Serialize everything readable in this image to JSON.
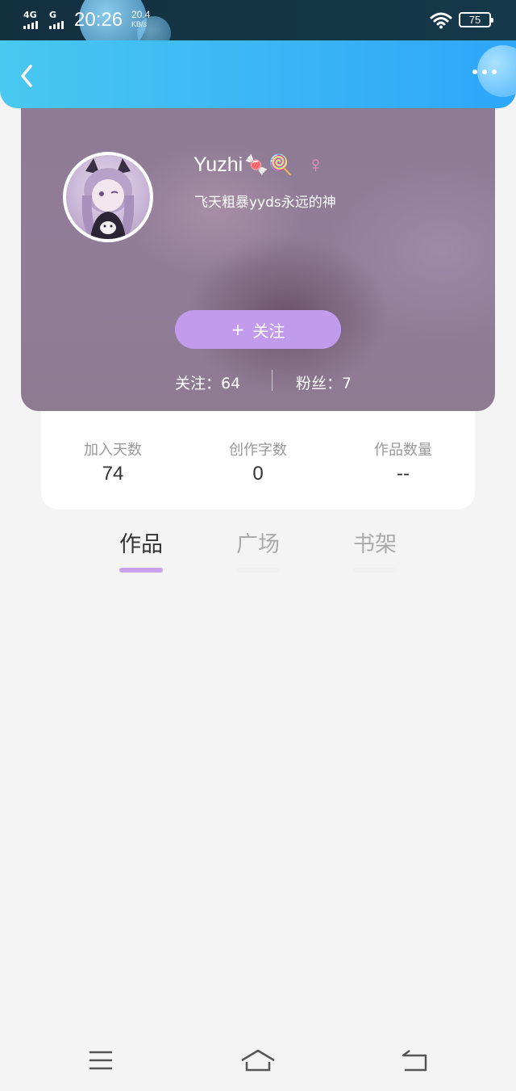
{
  "status_bar": {
    "network_1": "4G",
    "network_2": "G",
    "time": "20:26",
    "speed_value": "20.4",
    "speed_unit": "KB/s",
    "battery": "75"
  },
  "header": {
    "back_icon": "chevron-left-icon",
    "more_icon": "more-dots-icon"
  },
  "profile": {
    "name": "Yuzhi",
    "name_emoji": "🍬🍭",
    "gender_symbol": "♀",
    "bio": "飞天粗暴yyds永远的神",
    "follow_button": "关注",
    "follow_icon": "+",
    "following_label": "关注：",
    "following_count": "64",
    "fans_label": "粉丝：",
    "fans_count": "7"
  },
  "stats": [
    {
      "label": "加入天数",
      "value": "74"
    },
    {
      "label": "创作字数",
      "value": "0"
    },
    {
      "label": "作品数量",
      "value": "--"
    }
  ],
  "tabs": [
    {
      "label": "作品",
      "active": true
    },
    {
      "label": "广场",
      "active": false
    },
    {
      "label": "书架",
      "active": false
    }
  ],
  "colors": {
    "header_start": "#49c8f0",
    "header_end": "#2ea6fb",
    "accent_purple": "#c39bec",
    "tab_indicator": "#c9a2ea",
    "background": "#f4f4f4"
  },
  "bottom_nav": [
    "menu-icon",
    "home-icon",
    "back-icon"
  ]
}
